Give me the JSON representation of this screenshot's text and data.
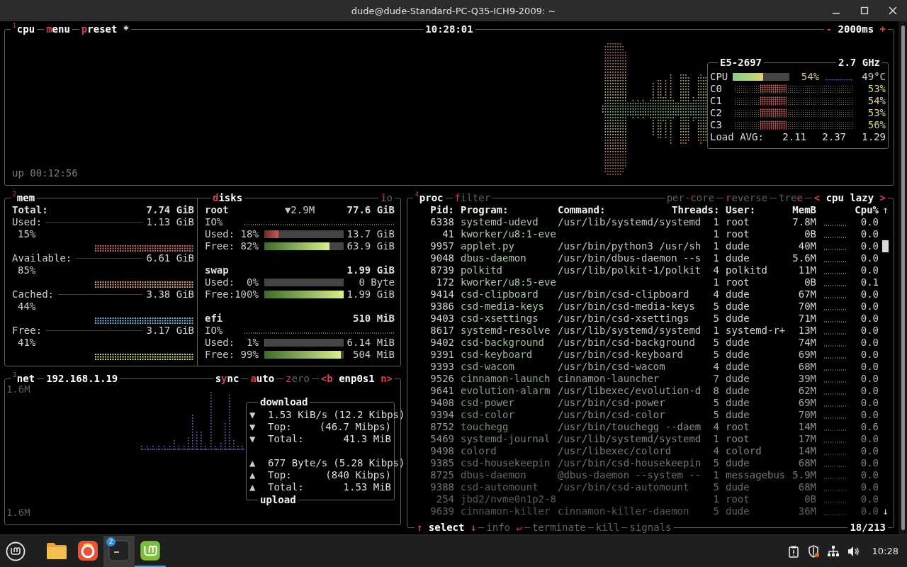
{
  "window": {
    "title": "dude@dude-Standard-PC-Q35-ICH9-2009: ~"
  },
  "cpu": {
    "tabs": [
      {
        "number": "1",
        "active": true,
        "parts": [
          {
            "text": "cpu",
            "hot": false
          }
        ]
      },
      {
        "active": true,
        "parts": [
          {
            "text": "m",
            "hot": true
          },
          {
            "text": "enu",
            "hot": false
          }
        ]
      },
      {
        "active": true,
        "parts": [
          {
            "text": "p",
            "hot": true
          },
          {
            "text": "reset *",
            "hot": false
          }
        ]
      }
    ],
    "clock": "10:28:01",
    "interval": {
      "active": true,
      "parts": [
        {
          "text": "-",
          "hot": true
        },
        {
          "text": " 2000ms ",
          "hot": false
        },
        {
          "text": "+",
          "hot": true
        }
      ]
    },
    "uptime": "up 00:12:56",
    "model": "E5-2697",
    "frequency": "2.7 GHz",
    "total": {
      "label": "CPU",
      "level": 0.54,
      "percent": "54%",
      "temperature": "49°C"
    },
    "cores": [
      {
        "label": "C0",
        "percent": "53%"
      },
      {
        "label": "C1",
        "percent": "54%"
      },
      {
        "label": "C2",
        "percent": "53%"
      },
      {
        "label": "C3",
        "percent": "56%"
      }
    ],
    "load": {
      "label": "Load AVG:",
      "values": [
        "2.11",
        "2.37",
        "1.29"
      ]
    }
  },
  "mem": {
    "tabs": [
      {
        "number": "2",
        "active": true,
        "parts": [
          {
            "text": "mem",
            "hot": false
          }
        ]
      }
    ],
    "total": {
      "label": "Total:",
      "value": "7.74 GiB"
    },
    "items": [
      {
        "label": "Used:",
        "value": "1.13 GiB",
        "percent": "15%",
        "color": "#c8645f"
      },
      {
        "label": "Available:",
        "value": "6.61 GiB",
        "percent": "85%",
        "color": "#d9a066"
      },
      {
        "label": "Cached:",
        "value": "3.38 GiB",
        "percent": "44%",
        "color": "#6fb7e0"
      },
      {
        "label": "Free:",
        "value": "3.17 GiB",
        "percent": "41%",
        "color": "#c4dc6f"
      }
    ]
  },
  "disks": {
    "tabs": [
      {
        "active": true,
        "parts": [
          {
            "text": "d",
            "hot": true
          },
          {
            "text": "isks",
            "hot": false
          }
        ]
      }
    ],
    "io_tab": {
      "active": false,
      "parts": [
        {
          "text": "i",
          "hot": true
        },
        {
          "text": "o",
          "hot": false
        }
      ]
    },
    "items": [
      {
        "name": "root",
        "io": "▼2.9M",
        "size": "77.6 GiB",
        "io_label": "IO%",
        "rows": [
          {
            "kind": "used",
            "label": "Used:",
            "percent": "18%",
            "level": 0.18,
            "value": "13.7 GiB"
          },
          {
            "kind": "free",
            "label": "Free:",
            "percent": "82%",
            "level": 0.82,
            "value": "63.9 GiB"
          }
        ]
      },
      {
        "name": "swap",
        "size": "1.99 GiB",
        "rows": [
          {
            "kind": "used",
            "label": "Used:",
            "percent": "0%",
            "level": 0,
            "value": "0 Byte"
          },
          {
            "kind": "free",
            "label": "Free:",
            "percent": "100%",
            "level": 1,
            "value": "1.99 GiB"
          }
        ]
      },
      {
        "name": "efi",
        "size": "510 MiB",
        "io_label": "IO%",
        "rows": [
          {
            "kind": "used",
            "label": "Used:",
            "percent": "1%",
            "level": 0.01,
            "value": "6.14 MiB"
          },
          {
            "kind": "free",
            "label": "Free:",
            "percent": "99%",
            "level": 0.97,
            "value": "504 MiB"
          }
        ]
      }
    ]
  },
  "net": {
    "tabs": [
      {
        "number": "3",
        "active": true,
        "parts": [
          {
            "text": "net",
            "hot": false
          }
        ]
      },
      {
        "active": true,
        "parts": [
          {
            "text": "192.168.1.19",
            "hot": false
          }
        ]
      }
    ],
    "options": [
      {
        "active": true,
        "parts": [
          {
            "text": "s",
            "hot": false
          },
          {
            "text": "y",
            "hot": true
          },
          {
            "text": "nc",
            "hot": false
          }
        ]
      },
      {
        "active": true,
        "parts": [
          {
            "text": "a",
            "hot": true
          },
          {
            "text": "uto",
            "hot": false
          }
        ]
      },
      {
        "active": false,
        "parts": [
          {
            "text": "z",
            "hot": true
          },
          {
            "text": "ero",
            "hot": false
          }
        ]
      },
      {
        "active": true,
        "parts": [
          {
            "text": "<b",
            "hot": true
          },
          {
            "text": " enp0s1 ",
            "hot": false
          },
          {
            "text": "n>",
            "hot": true
          }
        ]
      }
    ],
    "scale_top": "1.6M",
    "scale_bottom": "1.6M",
    "download": {
      "title": "download",
      "rows": [
        {
          "arrow": "▼",
          "label": "1.53 KiB/s",
          "value": "(12.2 Kibps)"
        },
        {
          "arrow": "▼",
          "label": "Top:",
          "value": "(46.7 Mibps)"
        },
        {
          "arrow": "▼",
          "label": "Total:",
          "value": "41.3 MiB"
        }
      ]
    },
    "upload": {
      "title": "upload",
      "rows": [
        {
          "arrow": "▲",
          "label": "677 Byte/s",
          "value": "(5.28 Kibps)"
        },
        {
          "arrow": "▲",
          "label": "Top:",
          "value": "(840 Kibps)"
        },
        {
          "arrow": "▲",
          "label": "Total:",
          "value": "1.53 MiB"
        }
      ]
    }
  },
  "proc": {
    "tabs": [
      {
        "number": "4",
        "active": true,
        "parts": [
          {
            "text": "proc",
            "hot": false
          }
        ]
      },
      {
        "active": false,
        "parts": [
          {
            "text": "f",
            "hot": true
          },
          {
            "text": "ilter",
            "hot": false
          }
        ]
      }
    ],
    "options": [
      {
        "active": false,
        "parts": [
          {
            "text": "per-",
            "hot": false
          },
          {
            "text": "c",
            "hot": true
          },
          {
            "text": "ore",
            "hot": false
          }
        ]
      },
      {
        "active": false,
        "parts": [
          {
            "text": "r",
            "hot": true
          },
          {
            "text": "everse",
            "hot": false
          }
        ]
      },
      {
        "active": false,
        "parts": [
          {
            "text": "tre",
            "hot": false
          },
          {
            "text": "e",
            "hot": true
          }
        ]
      },
      {
        "active": true,
        "parts": [
          {
            "text": "<",
            "hot": true
          },
          {
            "text": " cpu lazy ",
            "hot": false
          },
          {
            "text": ">",
            "hot": true
          }
        ]
      }
    ],
    "columns": [
      "Pid:",
      "Program:",
      "Command:",
      "Threads:",
      "User:",
      "MemB",
      "Cpu%"
    ],
    "sort_arrow": "↑",
    "rows": [
      {
        "pid": "6338",
        "program": "systemd-udevd",
        "command": "/usr/lib/systemd/systemd",
        "threads": "1",
        "user": "root",
        "mem": "7.8M",
        "cpu": "0.0"
      },
      {
        "pid": "41",
        "program": "kworker/u8:1-eve",
        "threads": "1",
        "user": "root",
        "mem": "0B",
        "cpu": "0.0"
      },
      {
        "pid": "9957",
        "program": "applet.py",
        "command": "/usr/bin/python3 /usr/sh",
        "threads": "1",
        "user": "dude",
        "mem": "40M",
        "cpu": "0.0"
      },
      {
        "pid": "9048",
        "program": "dbus-daemon",
        "command": "/usr/bin/dbus-daemon --s",
        "threads": "1",
        "user": "dude",
        "mem": "5.6M",
        "cpu": "0.0"
      },
      {
        "pid": "8739",
        "program": "polkitd",
        "command": "/usr/lib/polkit-1/polkit",
        "threads": "4",
        "user": "polkitd",
        "mem": "11M",
        "cpu": "0.0"
      },
      {
        "pid": "172",
        "program": "kworker/u8:5-eve",
        "threads": "1",
        "user": "root",
        "mem": "0B",
        "cpu": "0.1"
      },
      {
        "pid": "9414",
        "program": "csd-clipboard",
        "command": "/usr/bin/csd-clipboard",
        "threads": "4",
        "user": "dude",
        "mem": "67M",
        "cpu": "0.0"
      },
      {
        "pid": "9386",
        "program": "csd-media-keys",
        "command": "/usr/bin/csd-media-keys",
        "threads": "5",
        "user": "dude",
        "mem": "70M",
        "cpu": "0.0"
      },
      {
        "pid": "9403",
        "program": "csd-xsettings",
        "command": "/usr/bin/csd-xsettings",
        "threads": "5",
        "user": "dude",
        "mem": "71M",
        "cpu": "0.0"
      },
      {
        "pid": "8617",
        "program": "systemd-resolve",
        "command": "/usr/lib/systemd/systemd",
        "threads": "1",
        "user": "systemd-r+",
        "mem": "13M",
        "cpu": "0.0"
      },
      {
        "pid": "9402",
        "program": "csd-background",
        "command": "/usr/bin/csd-background",
        "threads": "5",
        "user": "dude",
        "mem": "74M",
        "cpu": "0.0"
      },
      {
        "pid": "9391",
        "program": "csd-keyboard",
        "command": "/usr/bin/csd-keyboard",
        "threads": "5",
        "user": "dude",
        "mem": "69M",
        "cpu": "0.0"
      },
      {
        "pid": "9393",
        "program": "csd-wacom",
        "command": "/usr/bin/csd-wacom",
        "threads": "4",
        "user": "dude",
        "mem": "68M",
        "cpu": "0.0"
      },
      {
        "pid": "9526",
        "program": "cinnamon-launch",
        "command": "cinnamon-launcher",
        "threads": "7",
        "user": "dude",
        "mem": "39M",
        "cpu": "0.0"
      },
      {
        "pid": "9641",
        "program": "evolution-alarm",
        "command": "/usr/libexec/evolution-d",
        "threads": "8",
        "user": "dude",
        "mem": "62M",
        "cpu": "0.0"
      },
      {
        "pid": "9408",
        "program": "csd-power",
        "command": "/usr/bin/csd-power",
        "threads": "5",
        "user": "dude",
        "mem": "69M",
        "cpu": "0.0"
      },
      {
        "pid": "9394",
        "program": "csd-color",
        "command": "/usr/bin/csd-color",
        "threads": "5",
        "user": "dude",
        "mem": "70M",
        "cpu": "0.0"
      },
      {
        "pid": "8752",
        "program": "touchegg",
        "command": "/usr/bin/touchegg --daem",
        "threads": "4",
        "user": "root",
        "mem": "14M",
        "cpu": "0.6"
      },
      {
        "pid": "5469",
        "program": "systemd-journal",
        "command": "/usr/lib/systemd/systemd",
        "threads": "1",
        "user": "root",
        "mem": "17M",
        "cpu": "0.0"
      },
      {
        "pid": "9498",
        "program": "colord",
        "command": "/usr/libexec/colord",
        "threads": "4",
        "user": "colord",
        "mem": "14M",
        "cpu": "0.0"
      },
      {
        "pid": "9385",
        "program": "csd-housekeepin",
        "command": "/usr/bin/csd-housekeepin",
        "threads": "5",
        "user": "dude",
        "mem": "68M",
        "cpu": "0.0"
      },
      {
        "pid": "8725",
        "program": "dbus-daemon",
        "command": "@dbus-daemon --system --",
        "threads": "1",
        "user": "messagebus",
        "mem": "5.9M",
        "cpu": "0.0"
      },
      {
        "pid": "9388",
        "program": "csd-automount",
        "command": "/usr/bin/csd-automount",
        "threads": "5",
        "user": "dude",
        "mem": "68M",
        "cpu": "0.0"
      },
      {
        "pid": "254",
        "program": "jbd2/nvme0n1p2-8",
        "threads": "1",
        "user": "root",
        "mem": "0B",
        "cpu": "0.0"
      },
      {
        "pid": "9639",
        "program": "cinnamon-killer",
        "command": "cinnamon-killer-daemon",
        "threads": "5",
        "user": "dude",
        "mem": "36M",
        "cpu": "0.0"
      }
    ],
    "scroll_down": "↓",
    "footer": [
      {
        "active": true,
        "parts": [
          {
            "text": "↑",
            "hot": true
          },
          {
            "text": " select ",
            "hot": false
          },
          {
            "text": "↓",
            "hot": true
          }
        ]
      },
      {
        "active": false,
        "parts": [
          {
            "text": "info ",
            "hot": false
          },
          {
            "text": "↵",
            "hot": true
          }
        ]
      },
      {
        "active": false,
        "parts": [
          {
            "text": "terminate",
            "hot": false
          }
        ]
      },
      {
        "active": false,
        "parts": [
          {
            "text": "kill",
            "hot": false
          }
        ]
      },
      {
        "active": false,
        "parts": [
          {
            "text": "signals",
            "hot": false
          }
        ]
      }
    ],
    "count": "18/213"
  },
  "taskbar": {
    "apps": [
      {
        "kind": "files",
        "active": false,
        "running": false
      },
      {
        "kind": "browser",
        "active": false,
        "running": false
      },
      {
        "kind": "terminal",
        "active": true,
        "running": false,
        "badge": "2"
      },
      {
        "kind": "mint",
        "active": false,
        "running": true
      }
    ],
    "clock": "10:28"
  }
}
